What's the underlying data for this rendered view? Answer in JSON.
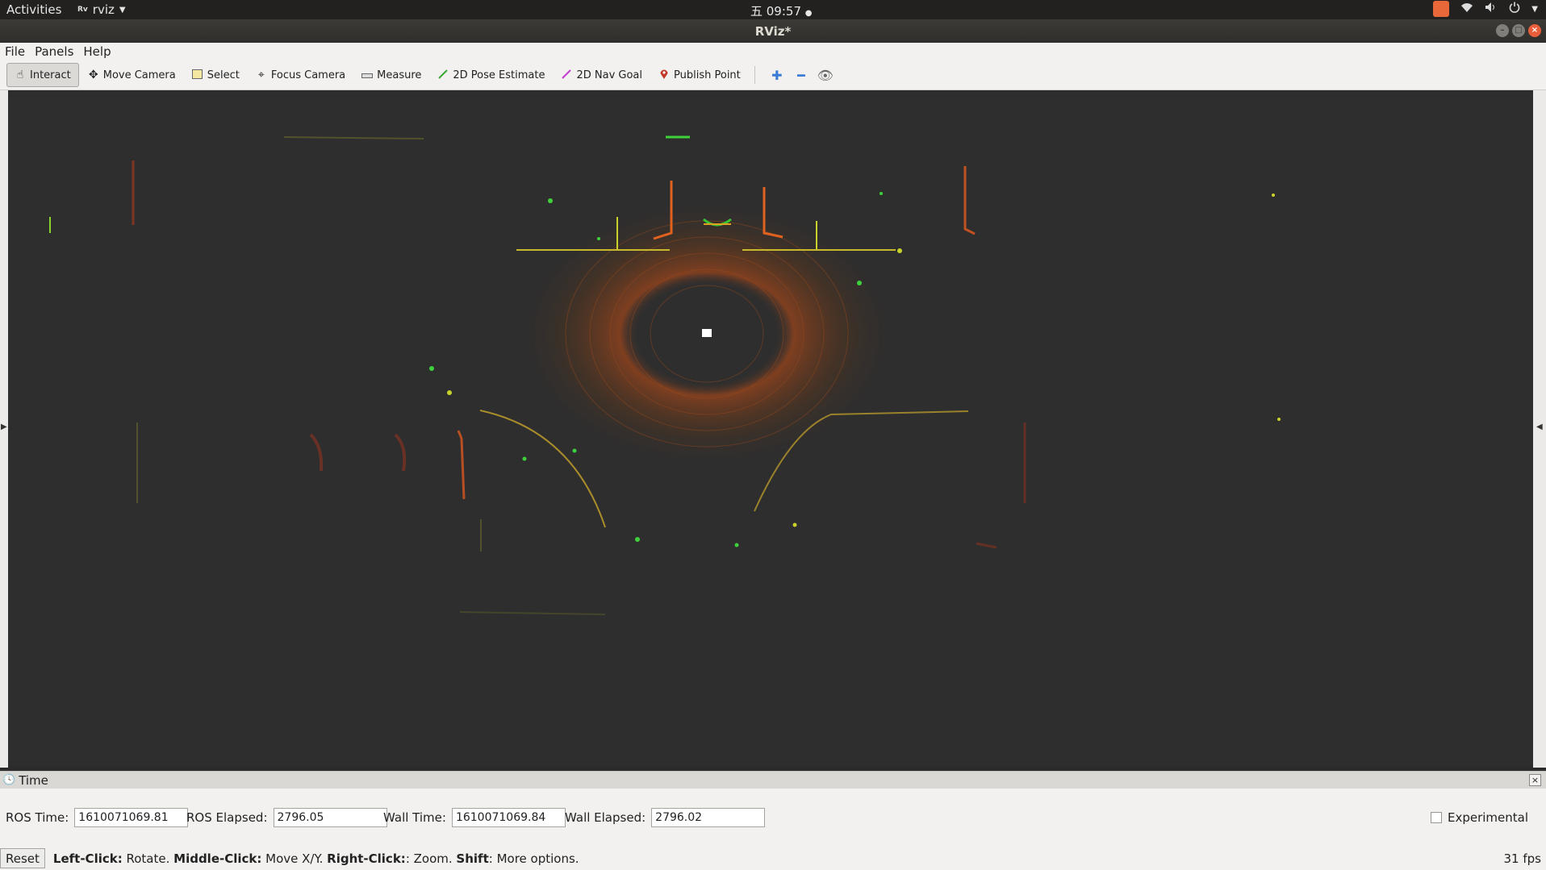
{
  "topbar": {
    "activities": "Activities",
    "app_icon": "Rv",
    "app_name": "rviz",
    "clock": "五 09:57"
  },
  "window": {
    "title": "RViz*"
  },
  "menu": {
    "file": "File",
    "panels": "Panels",
    "help": "Help"
  },
  "toolbar": {
    "interact": "Interact",
    "move_camera": "Move Camera",
    "select": "Select",
    "focus_camera": "Focus Camera",
    "measure": "Measure",
    "pose_estimate": "2D Pose Estimate",
    "nav_goal": "2D Nav Goal",
    "publish_point": "Publish Point"
  },
  "time_panel": {
    "title": "Time",
    "ros_time_label": "ROS Time:",
    "ros_time": "1610071069.81",
    "ros_elapsed_label": "ROS Elapsed:",
    "ros_elapsed": "2796.05",
    "wall_time_label": "Wall Time:",
    "wall_time": "1610071069.84",
    "wall_elapsed_label": "Wall Elapsed:",
    "wall_elapsed": "2796.02",
    "experimental": "Experimental"
  },
  "status": {
    "reset": "Reset",
    "k1": "Left-Click:",
    "v1": " Rotate. ",
    "k2": "Middle-Click:",
    "v2": " Move X/Y. ",
    "k3": "Right-Click:",
    "v3": ": Zoom. ",
    "k4": "Shift",
    "v4": ": More options.",
    "fps": "31 fps"
  },
  "colors": {
    "viewport_bg": "#2e2e2e",
    "point_orange": "#d9571f",
    "point_yellow": "#c9b82b",
    "point_green": "#3fd13c"
  }
}
